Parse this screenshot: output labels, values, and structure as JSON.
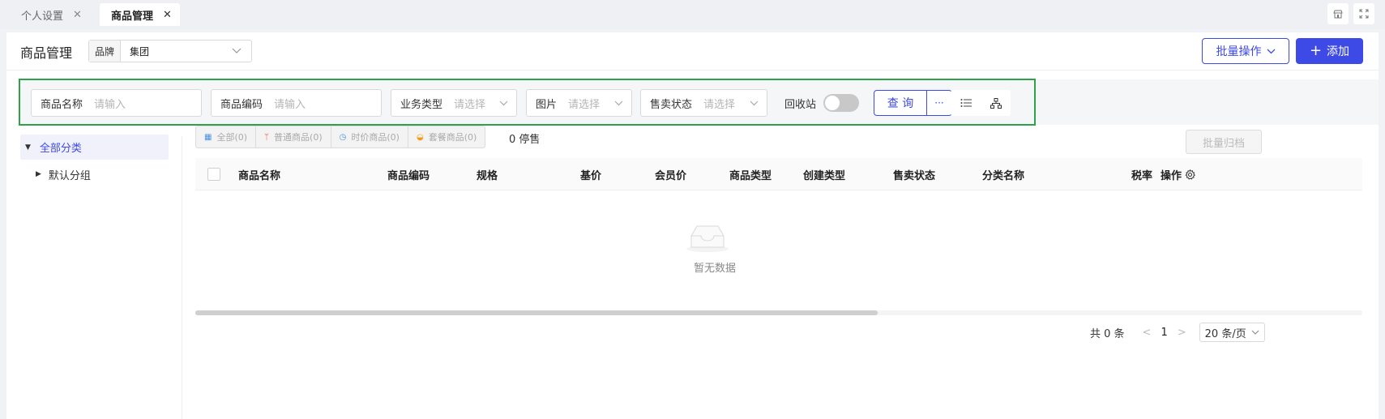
{
  "tabs": [
    {
      "label": "个人设置",
      "close": "✕"
    },
    {
      "label": "商品管理",
      "close": "✕"
    }
  ],
  "header": {
    "title": "商品管理",
    "brand_label": "品牌",
    "brand_value": "集团",
    "batch_label": "批量操作",
    "add_label": "添加"
  },
  "filters": {
    "name_label": "商品名称",
    "name_placeholder": "请输入",
    "code_label": "商品编码",
    "code_placeholder": "请输入",
    "biz_label": "业务类型",
    "biz_placeholder": "请选择",
    "img_label": "图片",
    "img_placeholder": "请选择",
    "sale_label": "售卖状态",
    "sale_placeholder": "请选择",
    "recycle_label": "回收站",
    "recycle_on": false,
    "query_label": "查 询",
    "more_label": "···"
  },
  "tree": {
    "all": "全部分类",
    "default": "默认分组"
  },
  "chips": [
    {
      "label": "全部(0)",
      "icon": "grid-icon",
      "color": "#4a90e2"
    },
    {
      "label": "普通商品(0)",
      "icon": "utensils-icon",
      "color": "#e74c3c"
    },
    {
      "label": "时价商品(0)",
      "icon": "clock-icon",
      "color": "#4a90e2"
    },
    {
      "label": "套餐商品(0)",
      "icon": "bowl-icon",
      "color": "#f39c12"
    }
  ],
  "stop_text": "0 停售",
  "archive_label": "批量归档",
  "table": {
    "columns": [
      "商品名称",
      "商品编码",
      "规格",
      "基价",
      "会员价",
      "商品类型",
      "创建类型",
      "售卖状态",
      "分类名称",
      "税率",
      "操作"
    ],
    "empty_text": "暂无数据"
  },
  "pagination": {
    "total": "共 0 条",
    "prev": "<",
    "page": "1",
    "next": ">",
    "size": "20 条/页"
  },
  "colors": {
    "accent": "#3d4ae6",
    "highlight_box": "#2ea24a"
  }
}
